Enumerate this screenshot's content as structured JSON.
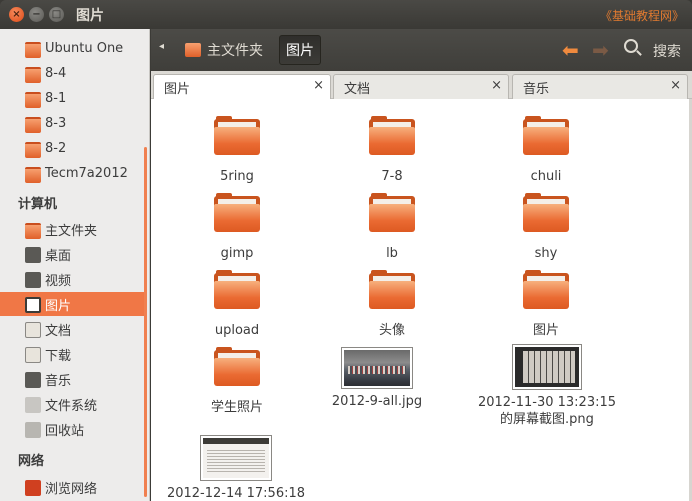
{
  "window": {
    "title": "图片",
    "watermark": "《基础教程网》"
  },
  "titlebar_buttons": {
    "close": "×",
    "minimize": "−",
    "maximize": "□"
  },
  "sidebar": {
    "items_top": [
      {
        "label": "Ubuntu One",
        "icon": "folder-icon"
      },
      {
        "label": "8-4",
        "icon": "folder-icon"
      },
      {
        "label": "8-1",
        "icon": "folder-icon"
      },
      {
        "label": "8-3",
        "icon": "folder-icon"
      },
      {
        "label": "8-2",
        "icon": "folder-icon"
      },
      {
        "label": "Tecm7a2012",
        "icon": "folder-icon"
      }
    ],
    "computer_heading": "计算机",
    "computer_items": [
      {
        "label": "主文件夹",
        "icon": "home-icon"
      },
      {
        "label": "桌面",
        "icon": "desktop-icon"
      },
      {
        "label": "视频",
        "icon": "video-icon"
      },
      {
        "label": "图片",
        "icon": "pictures-icon",
        "active": true
      },
      {
        "label": "文档",
        "icon": "documents-icon"
      },
      {
        "label": "下载",
        "icon": "download-icon"
      },
      {
        "label": "音乐",
        "icon": "music-icon"
      },
      {
        "label": "文件系统",
        "icon": "filesystem-icon"
      },
      {
        "label": "回收站",
        "icon": "trash-icon"
      }
    ],
    "network_heading": "网络",
    "network_items": [
      {
        "label": "浏览网络",
        "icon": "network-icon"
      }
    ]
  },
  "toolbar": {
    "breadcrumbs": [
      "主文件夹",
      "图片"
    ],
    "search_label": "搜索"
  },
  "tabs": [
    {
      "label": "图片",
      "active": true
    },
    {
      "label": "文档"
    },
    {
      "label": "音乐"
    }
  ],
  "tab_close": "×",
  "files": [
    {
      "name": "5ring",
      "kind": "folder"
    },
    {
      "name": "7-8",
      "kind": "folder"
    },
    {
      "name": "chuli",
      "kind": "folder"
    },
    {
      "name": "gimp",
      "kind": "folder"
    },
    {
      "name": "lb",
      "kind": "folder"
    },
    {
      "name": "shy",
      "kind": "folder"
    },
    {
      "name": "upload",
      "kind": "folder"
    },
    {
      "name": "头像",
      "kind": "folder"
    },
    {
      "name": "图片",
      "kind": "folder"
    },
    {
      "name": "学生照片",
      "kind": "folder"
    },
    {
      "name": "2012-9-all.jpg",
      "kind": "image"
    },
    {
      "name": "2012-11-30 13:23:15 的屏幕截图.png",
      "kind": "screenshot"
    },
    {
      "name": "2012-12-14 17:56:18",
      "kind": "dialog"
    }
  ],
  "colors": {
    "accent": "#f07746",
    "titlebar": "#3c3b37"
  }
}
